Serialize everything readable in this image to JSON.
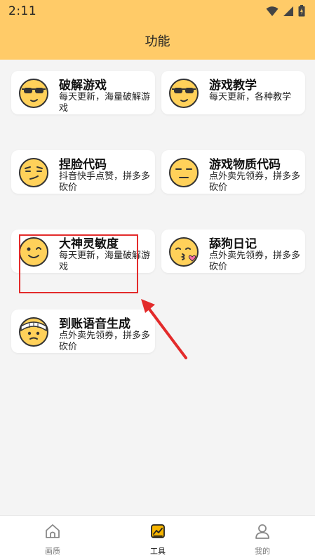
{
  "status_bar": {
    "time": "2:11"
  },
  "app_bar": {
    "title": "功能"
  },
  "cards": [
    {
      "title": "破解游戏",
      "desc": "每天更新，海量破解游戏",
      "icon": "sunglasses-emoji-icon"
    },
    {
      "title": "游戏教学",
      "desc": "每天更新，各种教学",
      "icon": "sunglasses-emoji-icon"
    },
    {
      "title": "捏脸代码",
      "desc": "抖音快手点赞，拼多多砍价",
      "icon": "smirk-emoji-icon"
    },
    {
      "title": "游戏物质代码",
      "desc": "点外卖先领券，拼多多砍价",
      "icon": "neutral-emoji-icon"
    },
    {
      "title": "大神灵敏度",
      "desc": "每天更新，海量破解游戏",
      "icon": "wink-emoji-icon"
    },
    {
      "title": "舔狗日记",
      "desc": "点外卖先领券，拼多多砍价",
      "icon": "kiss-emoji-icon"
    },
    {
      "title": "到账语音生成",
      "desc": "点外卖先领券，拼多多砍价",
      "icon": "bandaged-emoji-icon"
    }
  ],
  "bottom_nav": [
    {
      "label": "画质",
      "icon": "home-icon",
      "active": false
    },
    {
      "label": "工具",
      "icon": "tools-icon",
      "active": true
    },
    {
      "label": "我的",
      "icon": "profile-icon",
      "active": false
    }
  ],
  "colors": {
    "accent": "#ffcb68",
    "highlight": "#e32b2b",
    "emoji": "#ffd15a"
  }
}
